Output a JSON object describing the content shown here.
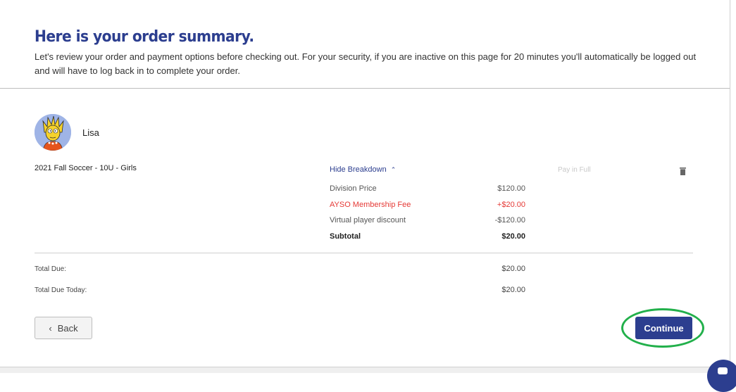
{
  "header": {
    "title": "Here is your order summary.",
    "subtitle": "Let's review your order and payment options before checking out. For your security, if you are inactive on this page for 20 minutes you'll automatically be logged out and will have to log back in to complete your order."
  },
  "player": {
    "name": "Lisa",
    "avatar_icon": "lisa-simpson-avatar-icon"
  },
  "order_item": {
    "program": "2021 Fall Soccer - 10U - Girls",
    "breakdown_toggle": "Hide Breakdown",
    "payment_option": "Pay in Full",
    "delete_icon": "trash-icon"
  },
  "breakdown": [
    {
      "label": "Division Price",
      "value": "$120.00"
    },
    {
      "label": "AYSO Membership Fee",
      "value": "+$20.00"
    },
    {
      "label": "Virtual player discount",
      "value": "-$120.00"
    },
    {
      "label": "Subtotal",
      "value": "$20.00"
    }
  ],
  "totals": [
    {
      "label": "Total Due:",
      "value": "$20.00"
    },
    {
      "label": "Total Due Today:",
      "value": "$20.00"
    }
  ],
  "actions": {
    "back_label": "Back",
    "continue_label": "Continue"
  },
  "colors": {
    "brand": "#2c3e8f",
    "fee_red": "#e53935",
    "highlight_green": "#22b04b"
  }
}
